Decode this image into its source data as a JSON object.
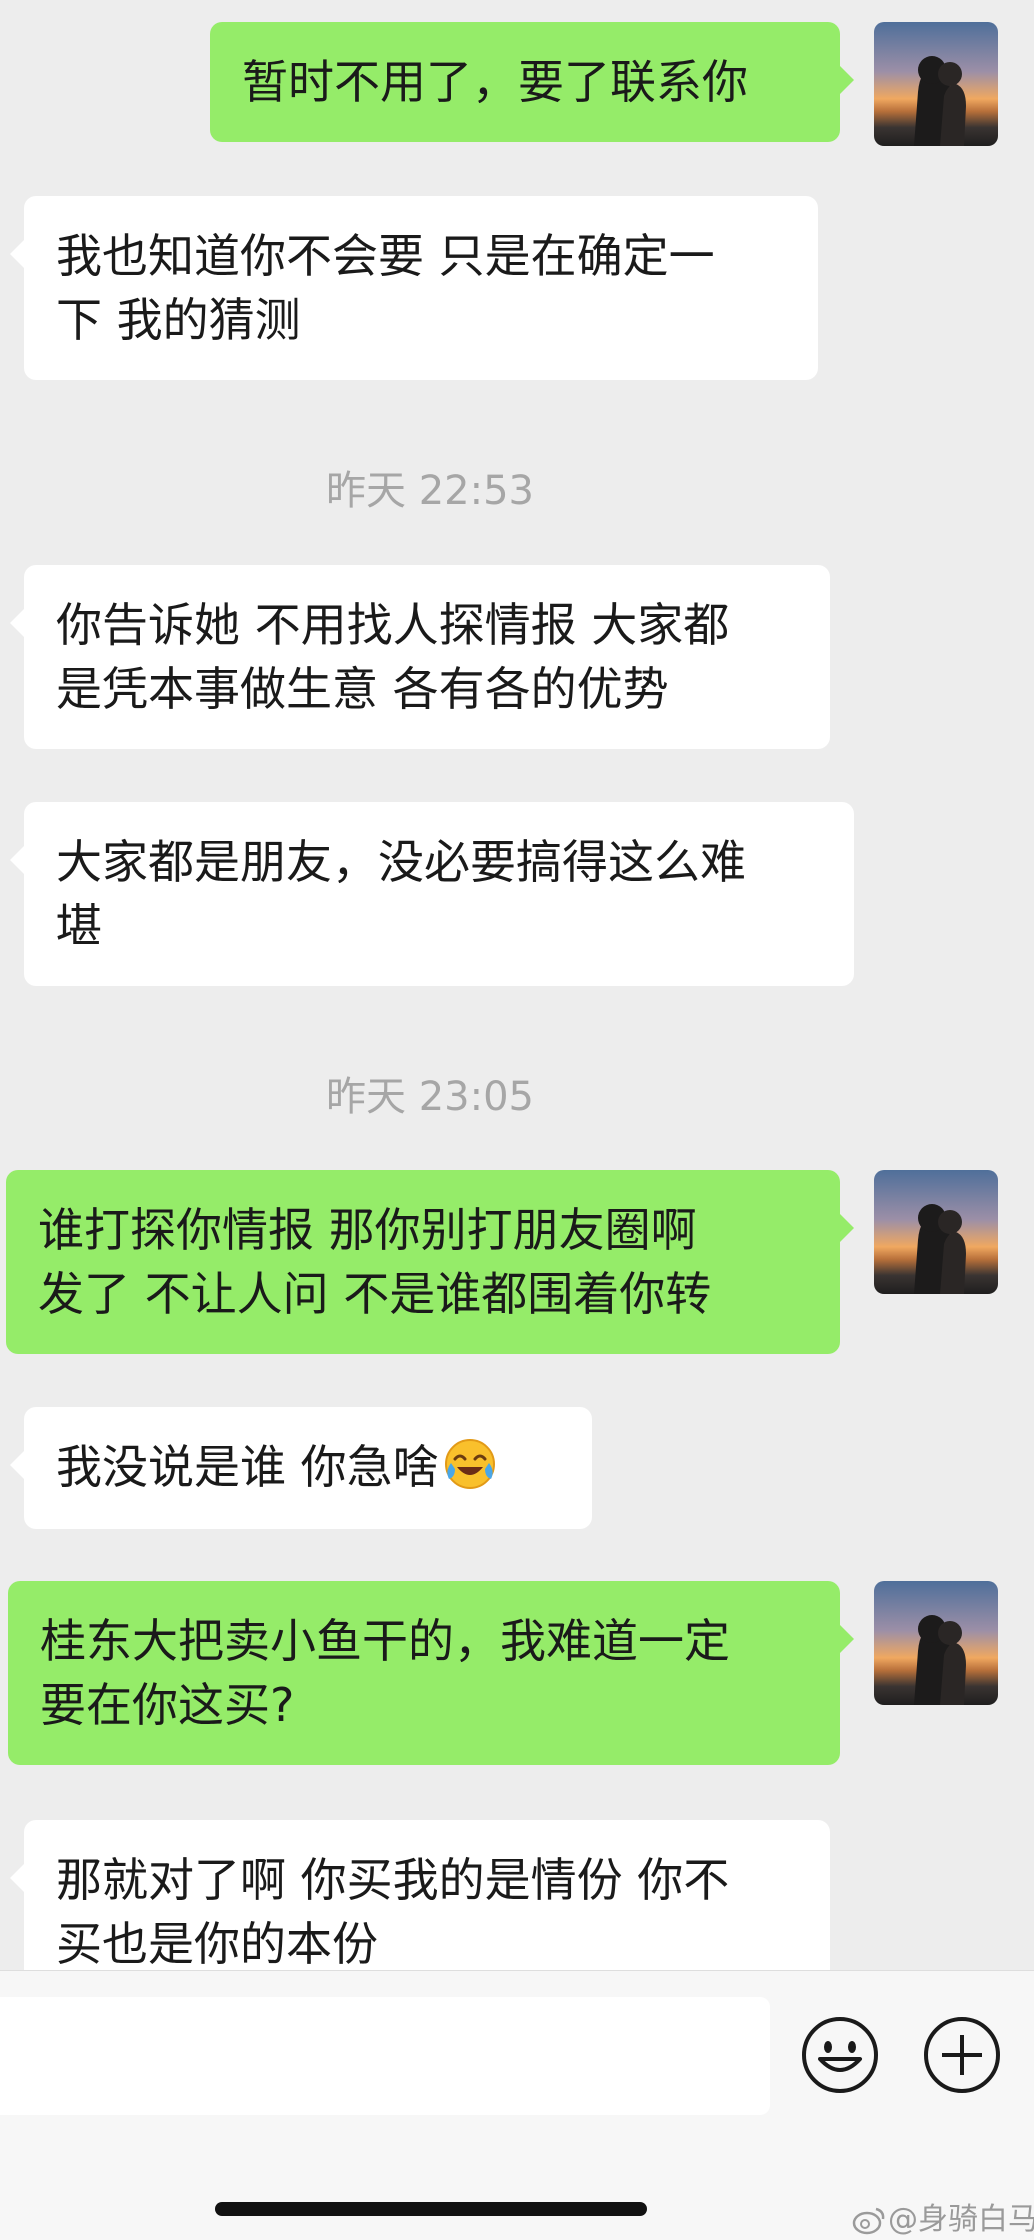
{
  "conversation": {
    "messages": [
      {
        "side": "right",
        "lines": [
          "暂时不用了，要了联系你"
        ]
      },
      {
        "side": "left",
        "lines": [
          "我也知道你不会要 只是在确定一",
          "下 我的猜测"
        ]
      },
      {
        "type": "timestamp",
        "text": "昨天 22:53"
      },
      {
        "side": "left",
        "lines": [
          "你告诉她 不用找人探情报 大家都",
          "是凭本事做生意 各有各的优势"
        ]
      },
      {
        "side": "left",
        "lines": [
          "大家都是朋友，没必要搞得这么难",
          "堪"
        ]
      },
      {
        "type": "timestamp",
        "text": "昨天 23:05"
      },
      {
        "side": "right",
        "lines": [
          "谁打探你情报  那你别打朋友圈啊",
          "发了 不让人问  不是谁都围着你转"
        ]
      },
      {
        "side": "left",
        "lines": [
          "我没说是谁 你急啥"
        ],
        "emoji": "face-with-tears-of-joy-icon"
      },
      {
        "side": "right",
        "lines": [
          "桂东大把卖小鱼干的，我难道一定",
          "要在你这买?"
        ]
      },
      {
        "side": "left",
        "lines": [
          "那就对了啊 你买我的是情份 你不",
          "买也是你的本份"
        ]
      }
    ]
  },
  "input_bar": {
    "value": "",
    "emoji_button_icon": "smiley-face-icon",
    "plus_button_icon": "plus-circle-icon"
  },
  "watermark": {
    "text": "@身骑白马",
    "icon": "weibo-icon"
  },
  "colors": {
    "background": "#ededed",
    "incoming_bubble": "#ffffff",
    "outgoing_bubble": "#95ec69",
    "timestamp": "#a6a6a6"
  }
}
